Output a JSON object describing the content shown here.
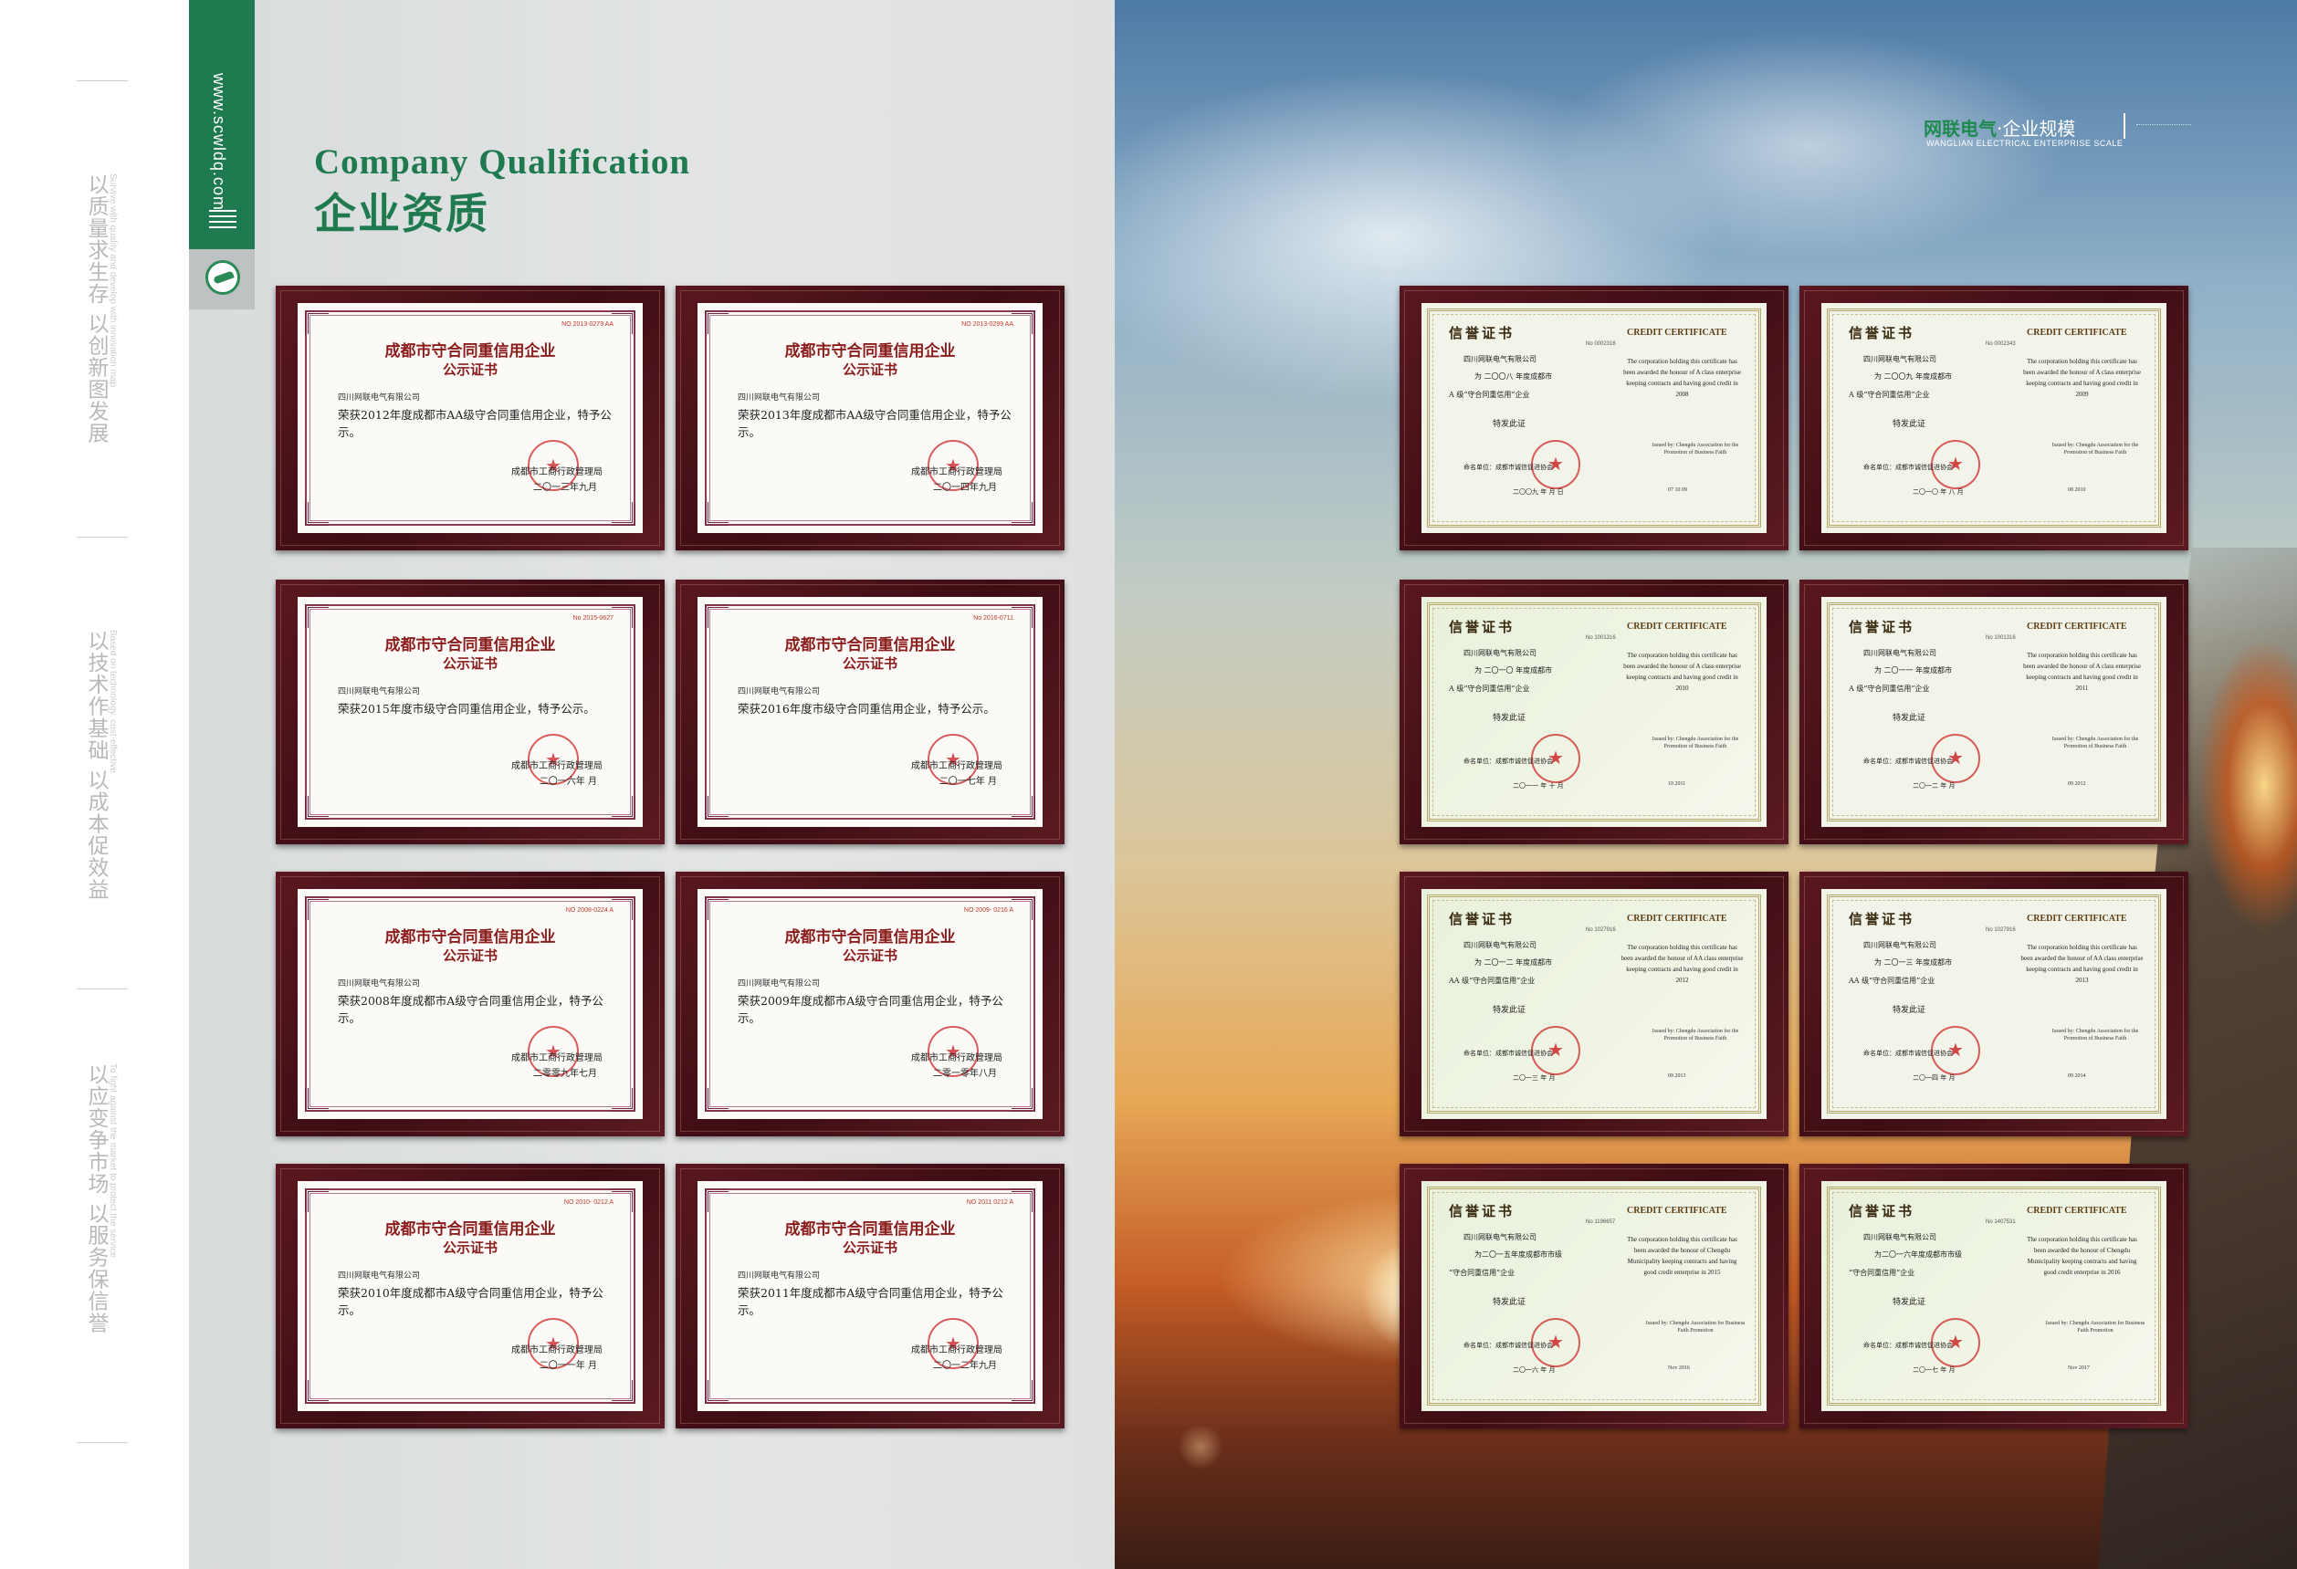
{
  "slogans": [
    {
      "zh": "以质量求生存 以创新图发展",
      "en": "Survive with quality and develop with innovation map"
    },
    {
      "zh": "以技术作基础 以成本促效益",
      "en": "Based on technology, cost-effective"
    },
    {
      "zh": "以应变争市场 以服务保信誉",
      "en": "To fight against the market to protect the service"
    }
  ],
  "side_tab": {
    "url": "www.scwldq.com"
  },
  "title": {
    "en": "Company Qualification",
    "zh": "企业资质"
  },
  "brand": {
    "name": "网联电气",
    "sep": "·",
    "section": "企业规模",
    "en": "WANGLIAN ELECTRICAL ENTERPRISE SCALE"
  },
  "colors": {
    "accent_green": "#1f7a4f",
    "plaque": "#4a1018",
    "cert_red": "#8a1c1c"
  },
  "left_certificates": [
    {
      "no": "NO 2013-0279 AA",
      "title1": "成都市守合同重信用企业",
      "title2": "公示证书",
      "company": "四川网联电气有限公司",
      "body": "荣获2012年度成都市AA级守合同重信用企业，特予公示。",
      "issuer": "成都市工商行政管理局",
      "date": "二〇一三年九月"
    },
    {
      "no": "NO 2013-0299 AA",
      "title1": "成都市守合同重信用企业",
      "title2": "公示证书",
      "company": "四川网联电气有限公司",
      "body": "荣获2013年度成都市AA级守合同重信用企业，特予公示。",
      "issuer": "成都市工商行政管理局",
      "date": "二〇一四年九月"
    },
    {
      "no": "No 2015-0627",
      "title1": "成都市守合同重信用企业",
      "title2": "公示证书",
      "company": "四川网联电气有限公司",
      "body": "荣获2015年度市级守合同重信用企业，特予公示。",
      "issuer": "成都市工商行政管理局",
      "date": "二〇一六年 月"
    },
    {
      "no": "No 2016-0711",
      "title1": "成都市守合同重信用企业",
      "title2": "公示证书",
      "company": "四川网联电气有限公司",
      "body": "荣获2016年度市级守合同重信用企业，特予公示。",
      "issuer": "成都市工商行政管理局",
      "date": "二〇一七年 月"
    },
    {
      "no": "NO 2008-0224 A",
      "title1": "成都市守合同重信用企业",
      "title2": "公示证书",
      "company": "四川网联电气有限公司",
      "body": "荣获2008年度成都市A级守合同重信用企业，特予公示。",
      "issuer": "成都市工商行政管理局",
      "date": "二零零九年七月"
    },
    {
      "no": "NO 2009- 0216 A",
      "title1": "成都市守合同重信用企业",
      "title2": "公示证书",
      "company": "四川网联电气有限公司",
      "body": "荣获2009年度成都市A级守合同重信用企业，特予公示。",
      "issuer": "成都市工商行政管理局",
      "date": "二零一零年八月"
    },
    {
      "no": "NO 2010- 0212 A",
      "title1": "成都市守合同重信用企业",
      "title2": "公示证书",
      "company": "四川网联电气有限公司",
      "body": "荣获2010年度成都市A级守合同重信用企业，特予公示。",
      "issuer": "成都市工商行政管理局",
      "date": "二〇一一年 月"
    },
    {
      "no": "NO 2011 0212 A",
      "title1": "成都市守合同重信用企业",
      "title2": "公示证书",
      "company": "四川网联电气有限公司",
      "body": "荣获2011年度成都市A级守合同重信用企业，特予公示。",
      "issuer": "成都市工商行政管理局",
      "date": "二〇一二年九月"
    }
  ],
  "right_certificates": [
    {
      "zh": "信誉证书",
      "en": "CREDIT CERTIFICATE",
      "no": "No 0002316",
      "company": "四川网联电气有限公司",
      "line1": "为 二〇〇八 年度成都市",
      "line2": "A 级“守合同重信用”企业",
      "line3": "特发此证",
      "en_body": "The corporation holding this certificate has been awarded the honour of A class enterprise keeping contracts and having good credit in 2008",
      "issued": "Issued by: Chengdu Association for the Promotion of Business Faith",
      "name_label": "命名单位：成都市诚信促进协会",
      "date_zh": "二〇〇九 年 月 日",
      "date_en": "07  10  09",
      "green": false
    },
    {
      "zh": "信誉证书",
      "en": "CREDIT CERTIFICATE",
      "no": "No 0002343",
      "company": "四川网联电气有限公司",
      "line1": "为 二〇〇九 年度成都市",
      "line2": "A 级“守合同重信用”企业",
      "line3": "特发此证",
      "en_body": "The corporation holding this certificate has been awarded the honour of A class enterprise keeping contracts and having good credit in 2009",
      "issued": "Issued by: Chengdu Association for the Promotion of Business Faith",
      "name_label": "命名单位：成都市诚信促进协会",
      "date_zh": "二〇一〇 年 八 月",
      "date_en": "08  2010",
      "green": false
    },
    {
      "zh": "信誉证书",
      "en": "CREDIT CERTIFICATE",
      "no": "No 1001316",
      "company": "四川网联电气有限公司",
      "line1": "为 二〇一〇 年度成都市",
      "line2": "A 级“守合同重信用”企业",
      "line3": "特发此证",
      "en_body": "The corporation holding this certificate has been awarded the honour of A class enterprise keeping contracts and having good credit in 2010",
      "issued": "Issued by: Chengdu Association for the Promotion of Business Faith",
      "name_label": "命名单位：成都市诚信促进协会",
      "date_zh": "二〇一一 年 十 月",
      "date_en": "10  2011",
      "green": true
    },
    {
      "zh": "信誉证书",
      "en": "CREDIT CERTIFICATE",
      "no": "No 1001316",
      "company": "四川网联电气有限公司",
      "line1": "为 二〇一一 年度成都市",
      "line2": "A 级“守合同重信用”企业",
      "line3": "特发此证",
      "en_body": "The corporation holding this certificate has been awarded the honour of A class enterprise keeping contracts and having good credit in 2011",
      "issued": "Issued by: Chengdu Association for the Promotion of Business Faith",
      "name_label": "命名单位：成都市诚信促进协会",
      "date_zh": "二〇一二 年 月",
      "date_en": "09  2012",
      "green": false
    },
    {
      "zh": "信誉证书",
      "en": "CREDIT CERTIFICATE",
      "no": "No 1027916",
      "company": "四川网联电气有限公司",
      "line1": "为 二〇一二 年度成都市",
      "line2": "AA 级“守合同重信用”企业",
      "line3": "特发此证",
      "en_body": "The corporation holding this certificate has been awarded the honour of AA class enterprise keeping contracts and having good credit in 2012",
      "issued": "Issued by: Chengdu Association for the Promotion of Business Faith",
      "name_label": "命名单位：成都市诚信促进协会",
      "date_zh": "二〇一三 年 月",
      "date_en": "09  2013",
      "green": true
    },
    {
      "zh": "信誉证书",
      "en": "CREDIT CERTIFICATE",
      "no": "No 1027916",
      "company": "四川网联电气有限公司",
      "line1": "为 二〇一三 年度成都市",
      "line2": "AA 级“守合同重信用”企业",
      "line3": "特发此证",
      "en_body": "The corporation holding this certificate has been awarded the honour of AA class enterprise keeping contracts and having good credit in 2013",
      "issued": "Issued by: Chengdu Association for the Promotion of Business Faith",
      "name_label": "命名单位：成都市诚信促进协会",
      "date_zh": "二〇一四 年 月",
      "date_en": "09  2014",
      "green": false
    },
    {
      "zh": "信誉证书",
      "en": "CREDIT CERTIFICATE",
      "no": "No 1196657",
      "company": "四川网联电气有限公司",
      "line1": "为二〇一五年度成都市市级",
      "line2": "“守合同重信用”企业",
      "line3": "特发此证",
      "en_body": "The corporation holding this certificate has been awarded the honour of Chengdu Municipality keeping contracts and having good credit enterprise in 2015",
      "issued": "Issued by: Chengdu Association for Business Faith Promotion",
      "name_label": "命名单位：成都市诚信促进协会",
      "date_zh": "二〇一六 年 月",
      "date_en": "Nov 2016",
      "green": true
    },
    {
      "zh": "信誉证书",
      "en": "CREDIT CERTIFICATE",
      "no": "No 1407531",
      "company": "四川网联电气有限公司",
      "line1": "为二〇一六年度成都市市级",
      "line2": "“守合同重信用”企业",
      "line3": "特发此证",
      "en_body": "The corporation holding this certificate has been awarded the honour of Chengdu Municipality keeping contracts and having good credit enterprise in 2016",
      "issued": "Issued by: Chengdu Association for Business Faith Promotion",
      "name_label": "命名单位：成都市诚信促进协会",
      "date_zh": "二〇一七 年 月",
      "date_en": "Nov 2017",
      "green": true
    }
  ]
}
